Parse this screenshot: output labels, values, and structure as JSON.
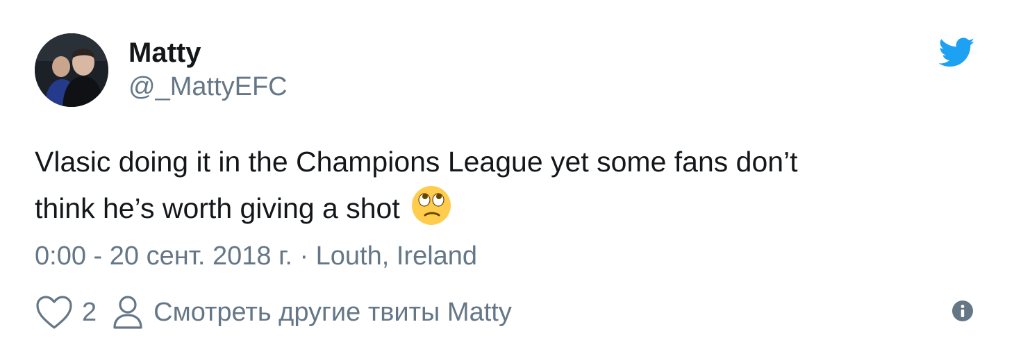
{
  "author": {
    "display_name": "Matty",
    "handle": "@_MattyEFC",
    "avatar_icon": "profile-photo"
  },
  "brand": {
    "icon": "twitter-bird-icon",
    "color": "#1da1f2"
  },
  "tweet": {
    "text": "Vlasic doing it in the Champions League yet some fans don’t\nthink he’s worth giving a shot ",
    "emoji": "face-with-rolling-eyes"
  },
  "meta": {
    "time": "0:00",
    "date": "20 сент. 2018 г.",
    "separator": "·",
    "location": "Louth, Ireland"
  },
  "actions": {
    "like_icon": "heart-icon",
    "like_count": "2",
    "more_icon": "person-icon",
    "more_label": "Смотреть другие твиты Matty",
    "info_icon": "info-icon"
  },
  "colors": {
    "text": "#14171a",
    "secondary": "#657786",
    "accent": "#1da1f2"
  }
}
